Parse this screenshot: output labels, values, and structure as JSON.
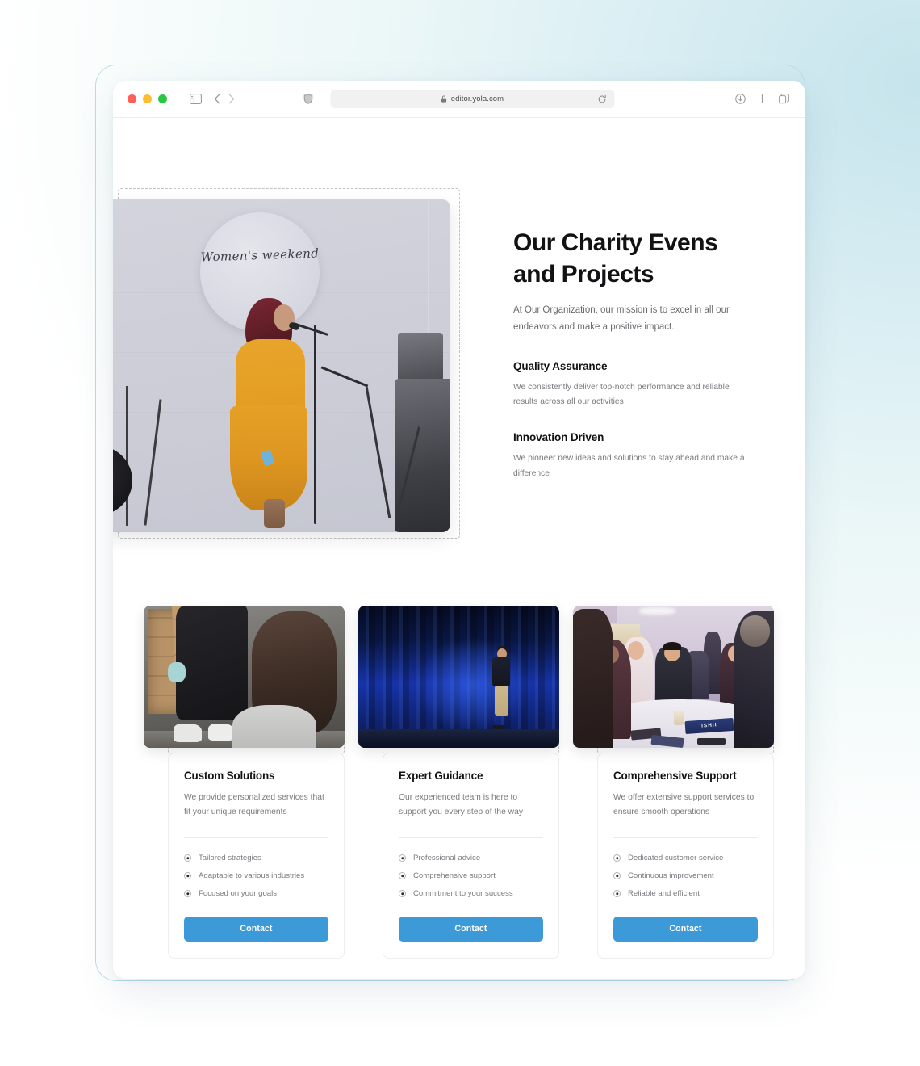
{
  "browser": {
    "url": "editor.yola.com",
    "traffic_lights": [
      "close-red",
      "minimize-yellow",
      "maximize-green"
    ],
    "left_icons": [
      "sidebar-toggle-icon",
      "back-arrow-icon",
      "forward-arrow-icon"
    ],
    "address_icons": [
      "shield-icon",
      "lock-icon",
      "reload-icon"
    ],
    "right_icons": [
      "download-icon",
      "new-tab-icon",
      "tab-overview-icon"
    ]
  },
  "hero": {
    "title": "Our Charity Evens and Projects",
    "subtitle": "At Our Organization, our mission is to excel in all our endeavors and make a positive impact.",
    "image_alt": "Woman in yellow dress singing at a microphone under a Women's weekend sign",
    "image_sign_text": "Women's weekend",
    "features": [
      {
        "title": "Quality Assurance",
        "description": "We consistently deliver top-notch performance and reliable results across all our activities"
      },
      {
        "title": "Innovation Driven",
        "description": "We pioneer new ideas and solutions to stay ahead and make a difference"
      }
    ]
  },
  "cards": [
    {
      "title": "Custom Solutions",
      "description": "We provide personalized services that fit your unique requirements",
      "image_alt": "Volunteers loading cardboard boxes",
      "items": [
        "Tailored strategies",
        "Adaptable to various industries",
        "Focused on your goals"
      ],
      "button_label": "Contact"
    },
    {
      "title": "Expert Guidance",
      "description": "Our experienced team is here to support you every step of the way",
      "image_alt": "Speaker presenting on a stage with blue curtains",
      "items": [
        "Professional advice",
        "Comprehensive support",
        "Commitment to your success"
      ],
      "button_label": "Contact"
    },
    {
      "title": "Comprehensive Support",
      "description": "We offer extensive support services to ensure smooth operations",
      "image_alt": "People talking around a conference round table",
      "image_placard_text": "ISHII",
      "items": [
        "Dedicated customer service",
        "Continuous improvement",
        "Reliable and efficient"
      ],
      "button_label": "Contact"
    }
  ],
  "colors": {
    "accent_blue": "#3d9ad9",
    "heading": "#121214",
    "body_text": "#7a7a80",
    "dropzone_border": "#c3c3c3",
    "page_background_right": "#cbe6ed",
    "page_background_left": "#f3faf8"
  }
}
